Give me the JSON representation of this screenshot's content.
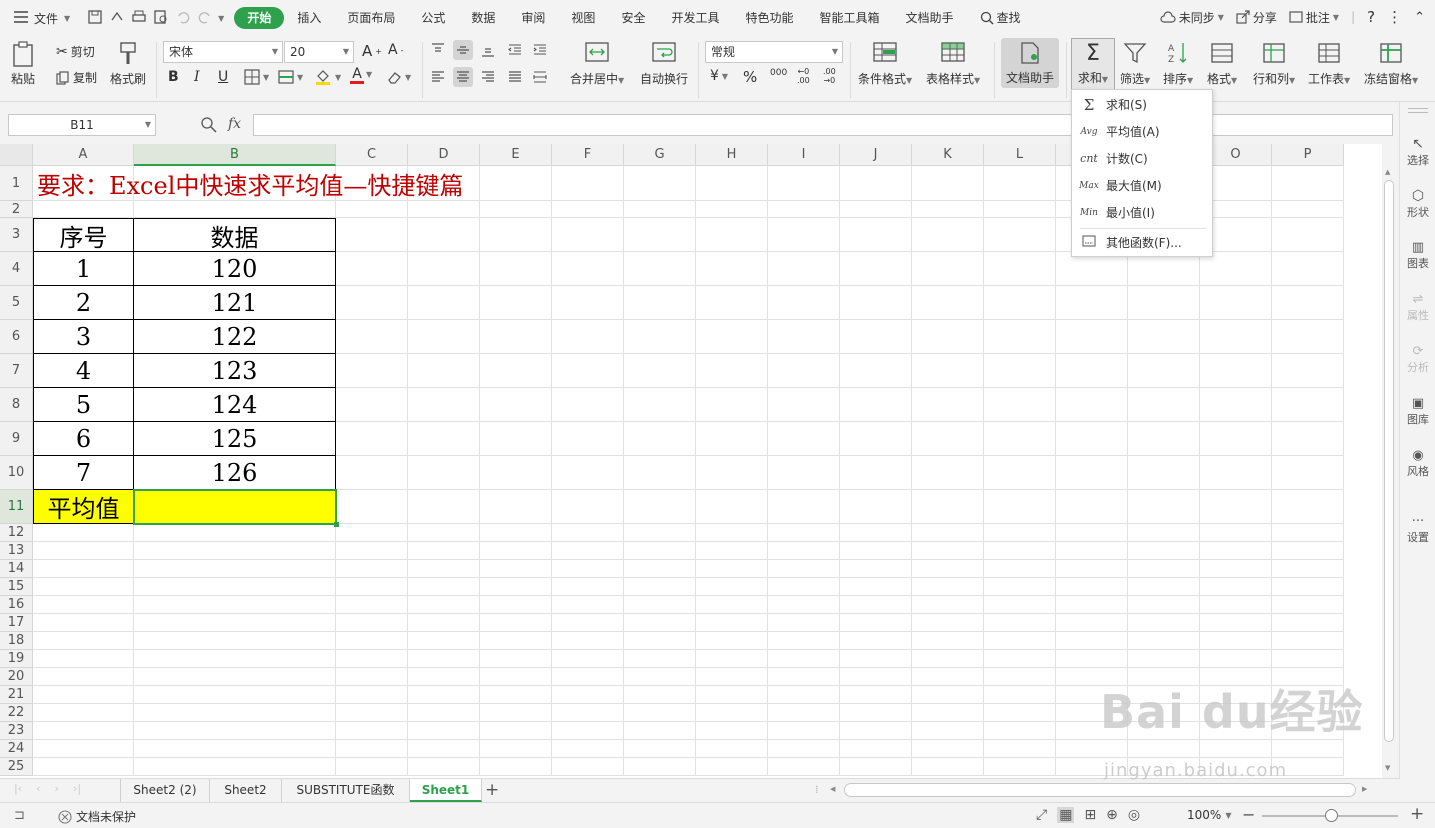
{
  "menubar": {
    "file_label": "文件",
    "tabs": [
      "开始",
      "插入",
      "页面布局",
      "公式",
      "数据",
      "审阅",
      "视图",
      "安全",
      "开发工具",
      "特色功能",
      "智能工具箱",
      "文档助手"
    ],
    "active_tab": "开始",
    "search_label": "查找",
    "sync_label": "未同步",
    "share_label": "分享",
    "annotate_label": "批注",
    "accent_color": "#2ea14c"
  },
  "ribbon": {
    "paste": "粘贴",
    "cut": "剪切",
    "copy": "复制",
    "format_painter": "格式刷",
    "font_name": "宋体",
    "font_size": "20",
    "merge_center": "合并居中",
    "wrap_text": "自动换行",
    "number_format": "常规",
    "cond_format": "条件格式",
    "table_style": "表格样式",
    "doc_assistant": "文档助手",
    "sum": "求和",
    "filter": "筛选",
    "sort": "排序",
    "format": "格式",
    "row_col": "行和列",
    "worksheet": "工作表",
    "freeze": "冻结窗格"
  },
  "formula_bar": {
    "name_box": "B11",
    "fx_label": "fx",
    "formula": ""
  },
  "columns": [
    "A",
    "B",
    "C",
    "D",
    "E",
    "F",
    "G",
    "H",
    "I",
    "J",
    "K",
    "L",
    "M",
    "N",
    "O",
    "P"
  ],
  "rows": [
    "1",
    "2",
    "3",
    "4",
    "5",
    "6",
    "7",
    "8",
    "9",
    "10",
    "11",
    "12",
    "13",
    "14",
    "15",
    "16",
    "17",
    "18",
    "19",
    "20",
    "21",
    "22",
    "23",
    "24",
    "25"
  ],
  "selected_cell": "B11",
  "sheet": {
    "title": "要求：Excel中快速求平均值—快捷键篇",
    "title_color": "#c00000",
    "header_a": "序号",
    "header_b": "数据",
    "seq": [
      "1",
      "2",
      "3",
      "4",
      "5",
      "6",
      "7"
    ],
    "data": [
      "120",
      "121",
      "122",
      "123",
      "124",
      "125",
      "126"
    ],
    "avg_label": "平均值",
    "avg_value": "",
    "highlight_color": "#ffff00"
  },
  "dropdown": {
    "items": [
      {
        "icon": "Σ",
        "label": "求和(S)"
      },
      {
        "icon": "Avg",
        "label": "平均值(A)"
      },
      {
        "icon": "cnt",
        "label": "计数(C)"
      },
      {
        "icon": "Max",
        "label": "最大值(M)"
      },
      {
        "icon": "Min",
        "label": "最小值(I)"
      },
      {
        "icon": "fx",
        "label": "其他函数(F)..."
      }
    ]
  },
  "sidepanel": [
    "选择",
    "形状",
    "图表",
    "属性",
    "分析",
    "图库",
    "风格",
    "设置"
  ],
  "sheet_tabs": [
    "Sheet2 (2)",
    "Sheet2",
    "SUBSTITUTE函数",
    "Sheet1"
  ],
  "active_sheet": "Sheet1",
  "statusbar": {
    "protect": "文档未保护",
    "zoom": "100%"
  },
  "watermark": {
    "brand": "Bai du经验",
    "url": "jingyan.baidu.com"
  }
}
